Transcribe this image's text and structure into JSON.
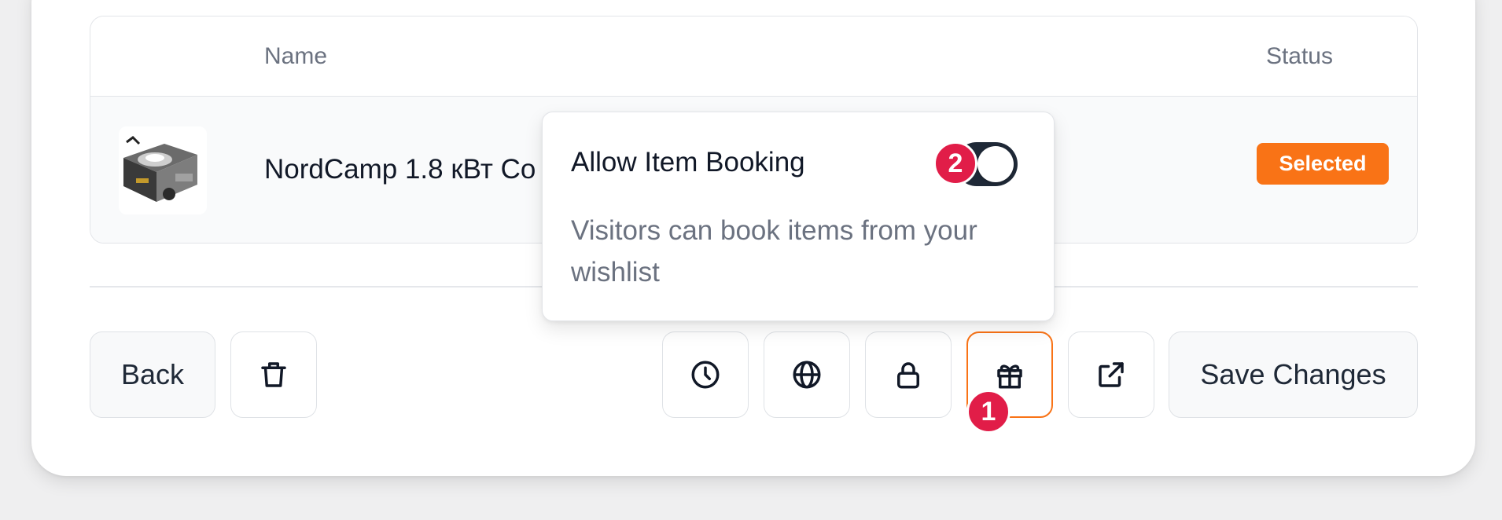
{
  "table": {
    "headers": {
      "name": "Name",
      "status": "Status"
    },
    "rows": [
      {
        "name": "NordCamp 1.8 кВт Co",
        "status": "Selected",
        "thumbnail_icon": "camping-stove-image"
      }
    ]
  },
  "popover": {
    "title": "Allow Item Booking",
    "description": "Visitors can book items from your wishlist",
    "toggle_state": "on"
  },
  "toolbar": {
    "back_label": "Back",
    "delete_icon": "trash-icon",
    "icons": [
      "clock-icon",
      "globe-icon",
      "lock-icon",
      "gift-icon",
      "external-link-icon"
    ],
    "save_label": "Save Changes"
  },
  "markers": {
    "first": "1",
    "second": "2"
  },
  "colors": {
    "accent": "#f97316",
    "toggle_on": "#1f2937",
    "marker": "#e11d48"
  }
}
